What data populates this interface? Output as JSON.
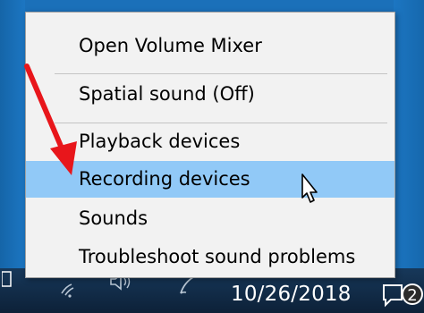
{
  "context_menu": {
    "items": [
      {
        "label": "Open Volume Mixer",
        "highlighted": false
      },
      {
        "label": "Spatial sound (Off)",
        "highlighted": false
      },
      {
        "label": "Playback devices",
        "highlighted": false
      },
      {
        "label": "Recording devices",
        "highlighted": true
      },
      {
        "label": "Sounds",
        "highlighted": false
      },
      {
        "label": "Troubleshoot sound problems",
        "highlighted": false
      }
    ]
  },
  "taskbar": {
    "date": "10/26/2018",
    "notification_count": "2"
  },
  "colors": {
    "menu_background": "#f2f2f2",
    "highlight": "#91c9f7",
    "annotation_arrow": "#e8161b",
    "taskbar": "#0f2a44",
    "desktop": "#1a6fb8"
  },
  "icons": {
    "tray": [
      "wifi-icon",
      "speaker-icon",
      "pen-icon"
    ],
    "notification": "action-center-icon",
    "annotation": "red-arrow",
    "pointer": "mouse-cursor"
  }
}
